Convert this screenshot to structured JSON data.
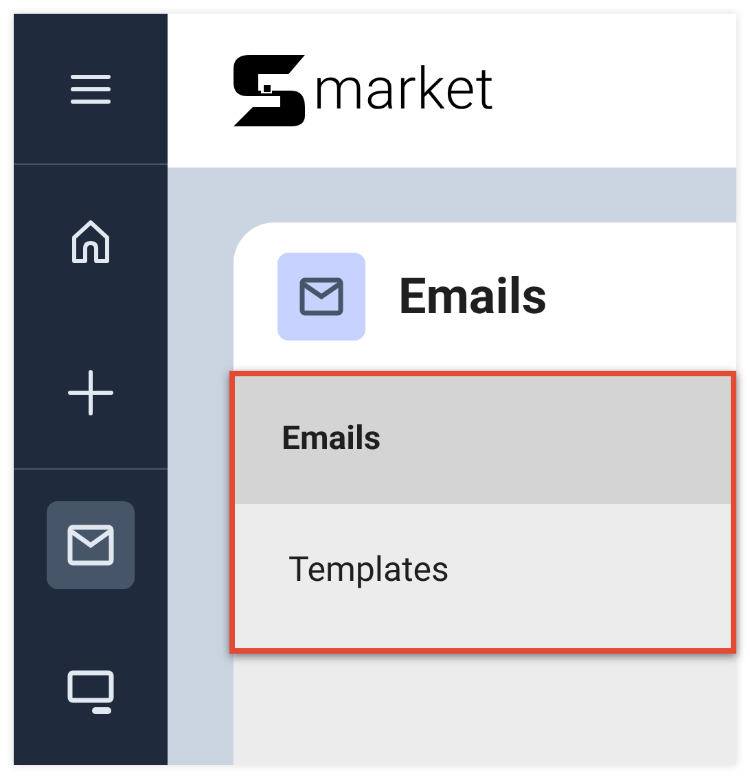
{
  "sidebar": {
    "items": [
      {
        "kind": "menu",
        "selected": false
      },
      {
        "kind": "home",
        "selected": false
      },
      {
        "kind": "add",
        "selected": false
      },
      {
        "kind": "mail",
        "selected": true
      },
      {
        "kind": "monitor",
        "selected": false
      }
    ]
  },
  "header": {
    "logo_text": "market"
  },
  "page": {
    "title": "Emails"
  },
  "submenu": {
    "items": [
      {
        "label": "Emails",
        "selected": true
      },
      {
        "label": "Templates",
        "selected": false
      }
    ]
  }
}
